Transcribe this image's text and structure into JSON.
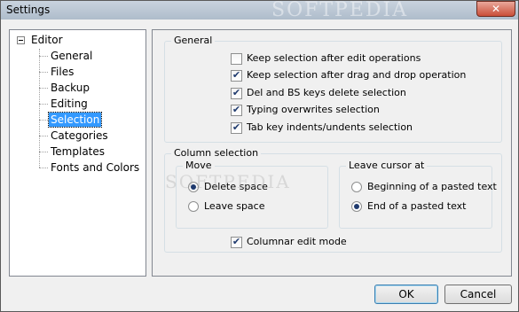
{
  "window": {
    "title": "Settings",
    "close_glyph": "✕",
    "watermark": "SOFTPEDIA"
  },
  "tree": {
    "root": {
      "expander": "−",
      "label": "Editor"
    },
    "items": [
      {
        "label": "General"
      },
      {
        "label": "Files"
      },
      {
        "label": "Backup"
      },
      {
        "label": "Editing"
      },
      {
        "label": "Selection",
        "selected": true
      },
      {
        "label": "Categories"
      },
      {
        "label": "Templates"
      },
      {
        "label": "Fonts and Colors"
      }
    ]
  },
  "general": {
    "title": "General",
    "options": [
      {
        "label": "Keep selection after edit operations",
        "checked": false
      },
      {
        "label": "Keep selection after drag and drop operation",
        "checked": true
      },
      {
        "label": "Del and BS keys delete selection",
        "checked": true
      },
      {
        "label": "Typing overwrites selection",
        "checked": true
      },
      {
        "label": "Tab key indents/undents selection",
        "checked": true
      }
    ]
  },
  "column_selection": {
    "title": "Column selection",
    "move": {
      "title": "Move",
      "options": [
        {
          "label": "Delete space",
          "selected": true
        },
        {
          "label": "Leave space",
          "selected": false
        }
      ]
    },
    "leave_cursor": {
      "title": "Leave cursor at",
      "options": [
        {
          "label": "Beginning of a pasted text",
          "selected": false
        },
        {
          "label": "End of a pasted text",
          "selected": true
        }
      ]
    },
    "columnar_edit": {
      "label": "Columnar edit mode",
      "checked": true
    }
  },
  "buttons": {
    "ok": "OK",
    "cancel": "Cancel"
  },
  "colors": {
    "selection_highlight": "#3399ff",
    "title_bar": "#bccad8",
    "close_button": "#c94e38"
  }
}
